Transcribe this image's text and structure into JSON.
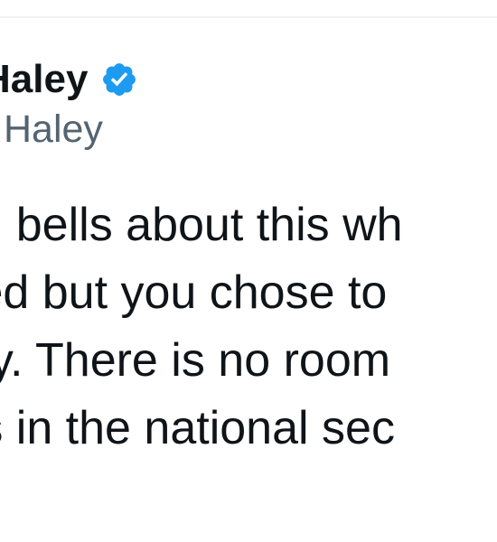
{
  "author": {
    "display_name": "Haley",
    "handle": "Haley",
    "verified": true,
    "verified_icon": "verified-badge-icon"
  },
  "tweet": {
    "lines": [
      "m bells about this wh",
      "ted but you chose to",
      "ay. There is no room",
      "rs in the national sec"
    ]
  },
  "colors": {
    "text": "#0f1419",
    "secondary": "#536471",
    "verified": "#1d9bf0",
    "divider": "#eff3f4"
  }
}
